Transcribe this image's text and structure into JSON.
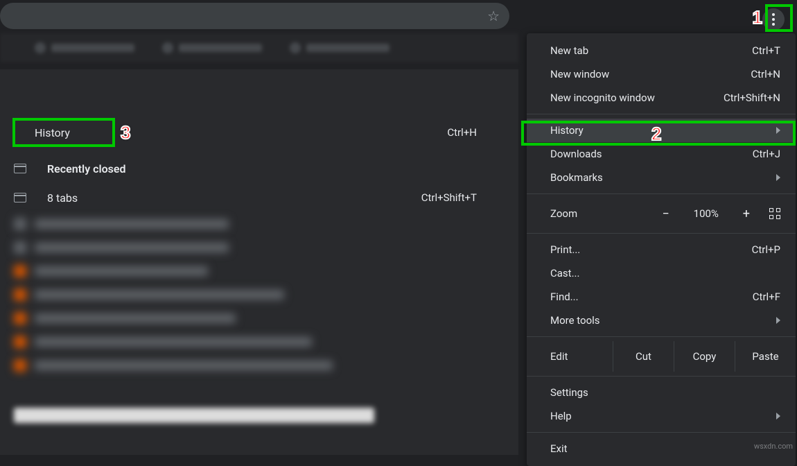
{
  "menu": {
    "new_tab": {
      "label": "New tab",
      "shortcut": "Ctrl+T"
    },
    "new_window": {
      "label": "New window",
      "shortcut": "Ctrl+N"
    },
    "incognito": {
      "label": "New incognito window",
      "shortcut": "Ctrl+Shift+N"
    },
    "history": {
      "label": "History"
    },
    "downloads": {
      "label": "Downloads",
      "shortcut": "Ctrl+J"
    },
    "bookmarks": {
      "label": "Bookmarks"
    },
    "zoom": {
      "label": "Zoom",
      "value": "100%",
      "minus": "−",
      "plus": "+"
    },
    "print": {
      "label": "Print...",
      "shortcut": "Ctrl+P"
    },
    "cast": {
      "label": "Cast..."
    },
    "find": {
      "label": "Find...",
      "shortcut": "Ctrl+F"
    },
    "more_tools": {
      "label": "More tools"
    },
    "edit": {
      "label": "Edit",
      "cut": "Cut",
      "copy": "Copy",
      "paste": "Paste"
    },
    "settings": {
      "label": "Settings"
    },
    "help": {
      "label": "Help"
    },
    "exit": {
      "label": "Exit"
    }
  },
  "submenu": {
    "history": {
      "label": "History",
      "shortcut": "Ctrl+H"
    },
    "recently": "Recently closed",
    "eight_tabs": {
      "label": "8 tabs",
      "shortcut": "Ctrl+Shift+T"
    }
  },
  "callouts": {
    "one": "1",
    "two": "2",
    "three": "3"
  },
  "blurred_widths": [
    280,
    280,
    250,
    360,
    290,
    400,
    430
  ],
  "blurred_colors": [
    "fi-gray",
    "fi-gray",
    "fi-orange",
    "fi-orange",
    "fi-orange",
    "fi-orange",
    "fi-orange"
  ],
  "watermark": "wsxdn.com"
}
